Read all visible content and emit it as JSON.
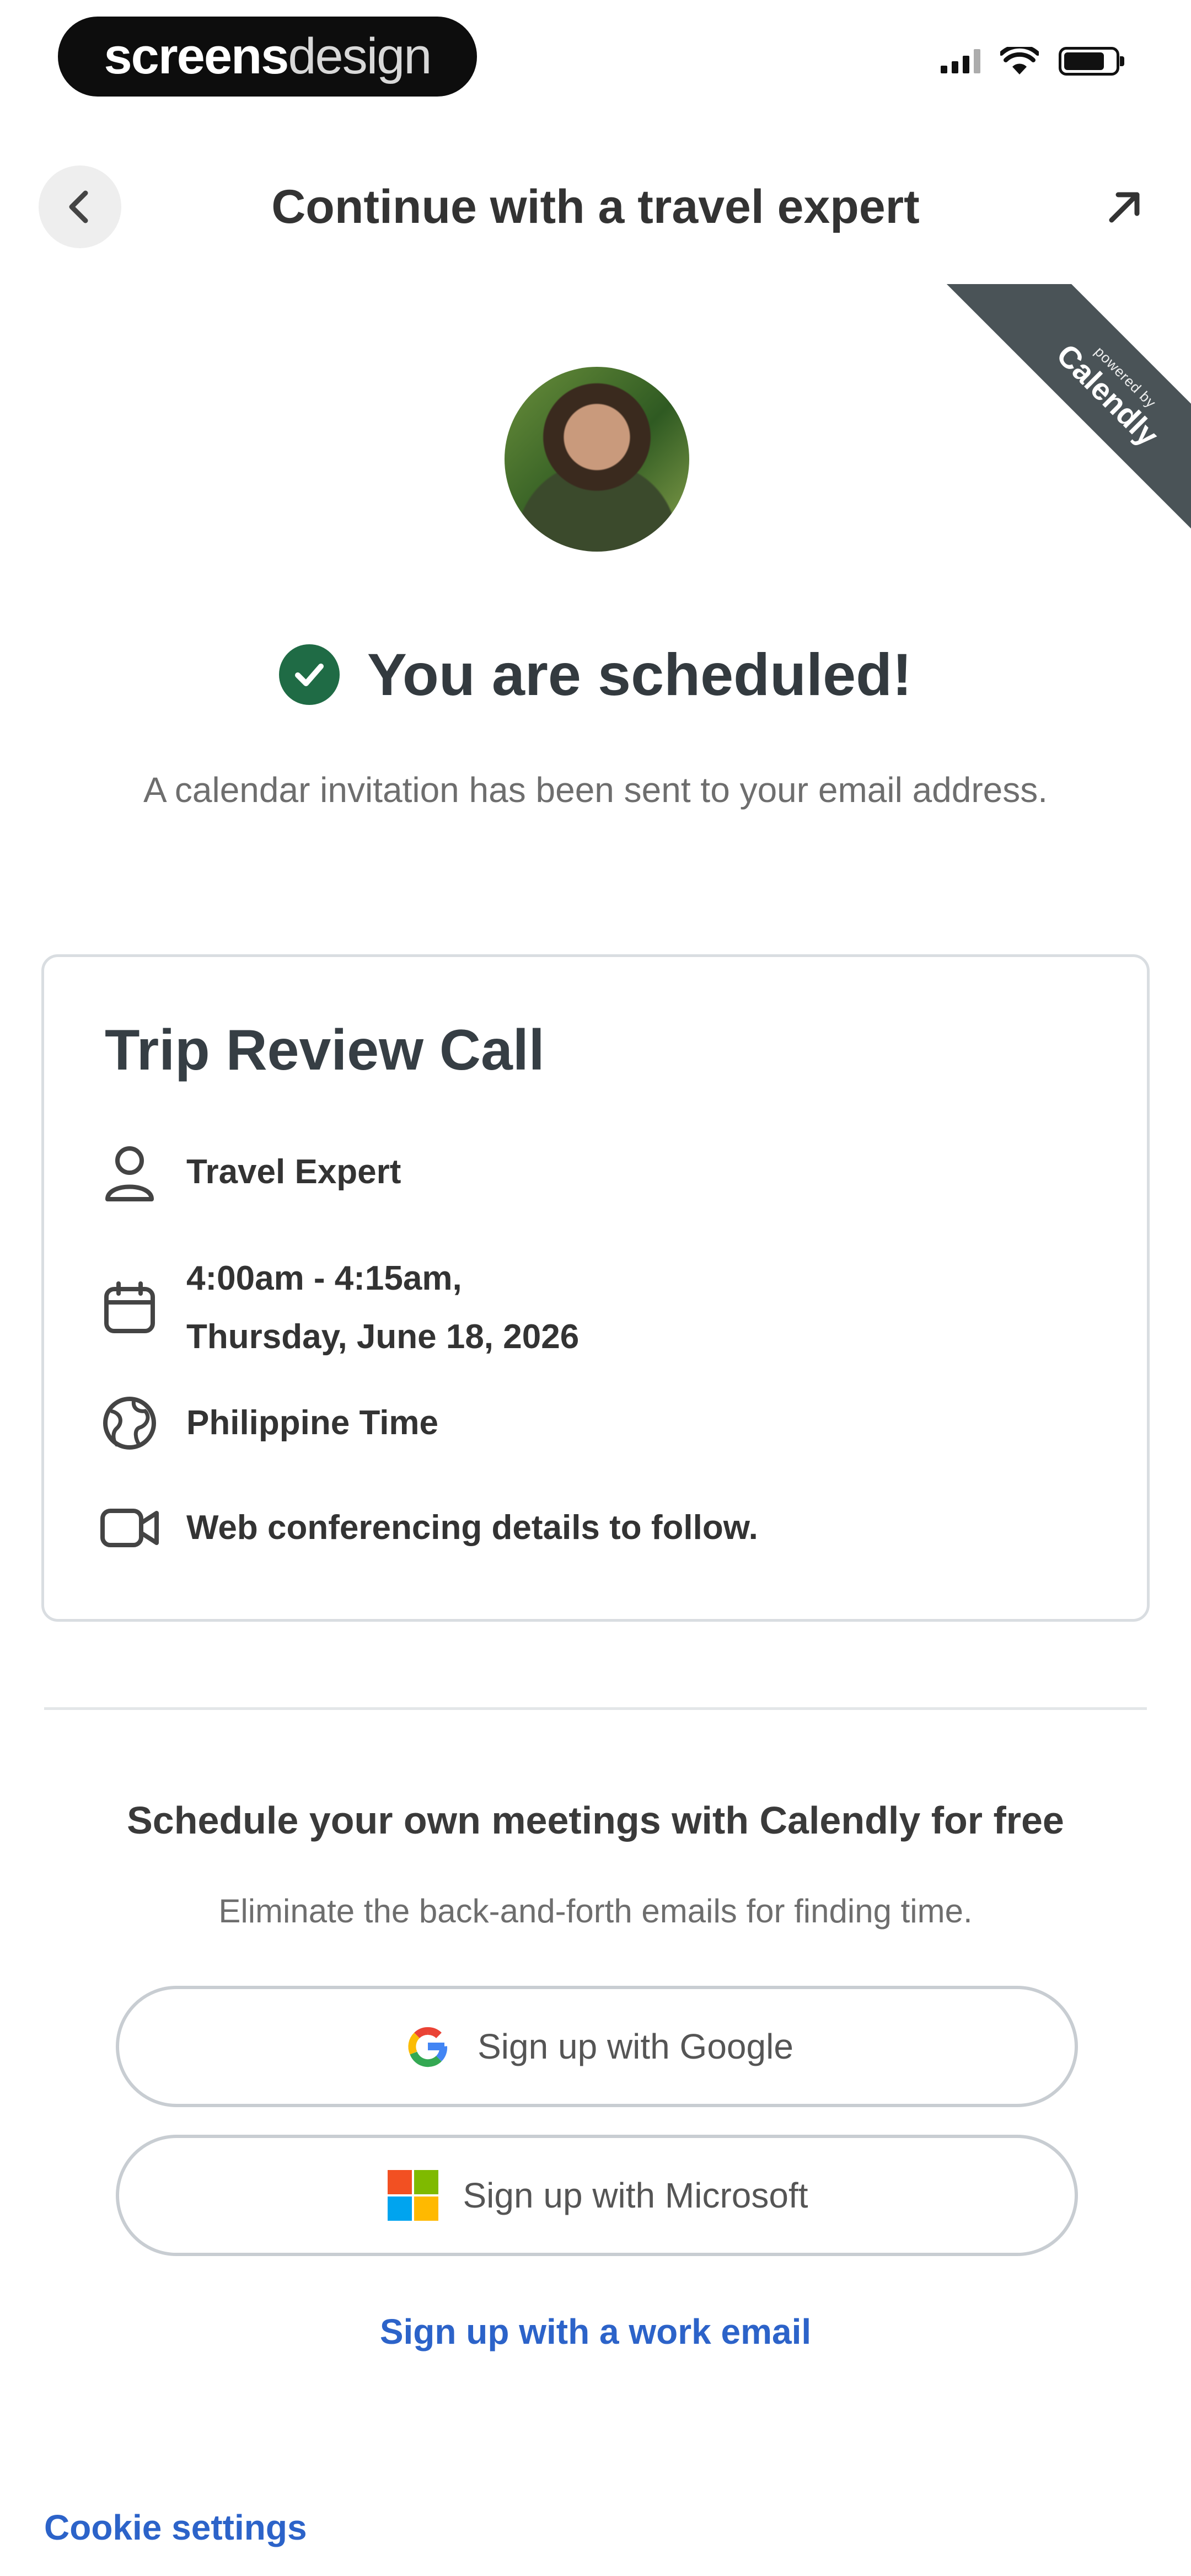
{
  "status_bar": {
    "brand_bold": "screens",
    "brand_light": "design"
  },
  "header": {
    "title": "Continue with a travel expert"
  },
  "ribbon": {
    "line1": "powered by",
    "line2": "Calendly"
  },
  "confirmation": {
    "title": "You are scheduled!",
    "subtitle": "A calendar invitation has been sent to your email address."
  },
  "event": {
    "title": "Trip Review Call",
    "host": "Travel Expert",
    "time_line1": "4:00am - 4:15am,",
    "time_line2": "Thursday, June 18, 2026",
    "timezone": "Philippine Time",
    "location": "Web conferencing details to follow."
  },
  "promo": {
    "title": "Schedule your own meetings with Calendly for free",
    "subtitle": "Eliminate the back-and-forth emails for finding time.",
    "google_label": "Sign up with Google",
    "microsoft_label": "Sign up with Microsoft",
    "work_email_label": "Sign up with a work email"
  },
  "footer": {
    "cookie_label": "Cookie settings"
  },
  "colors": {
    "accent_link": "#2c63c9",
    "success_green": "#1f6b45",
    "ribbon_gray": "#4a5357"
  }
}
